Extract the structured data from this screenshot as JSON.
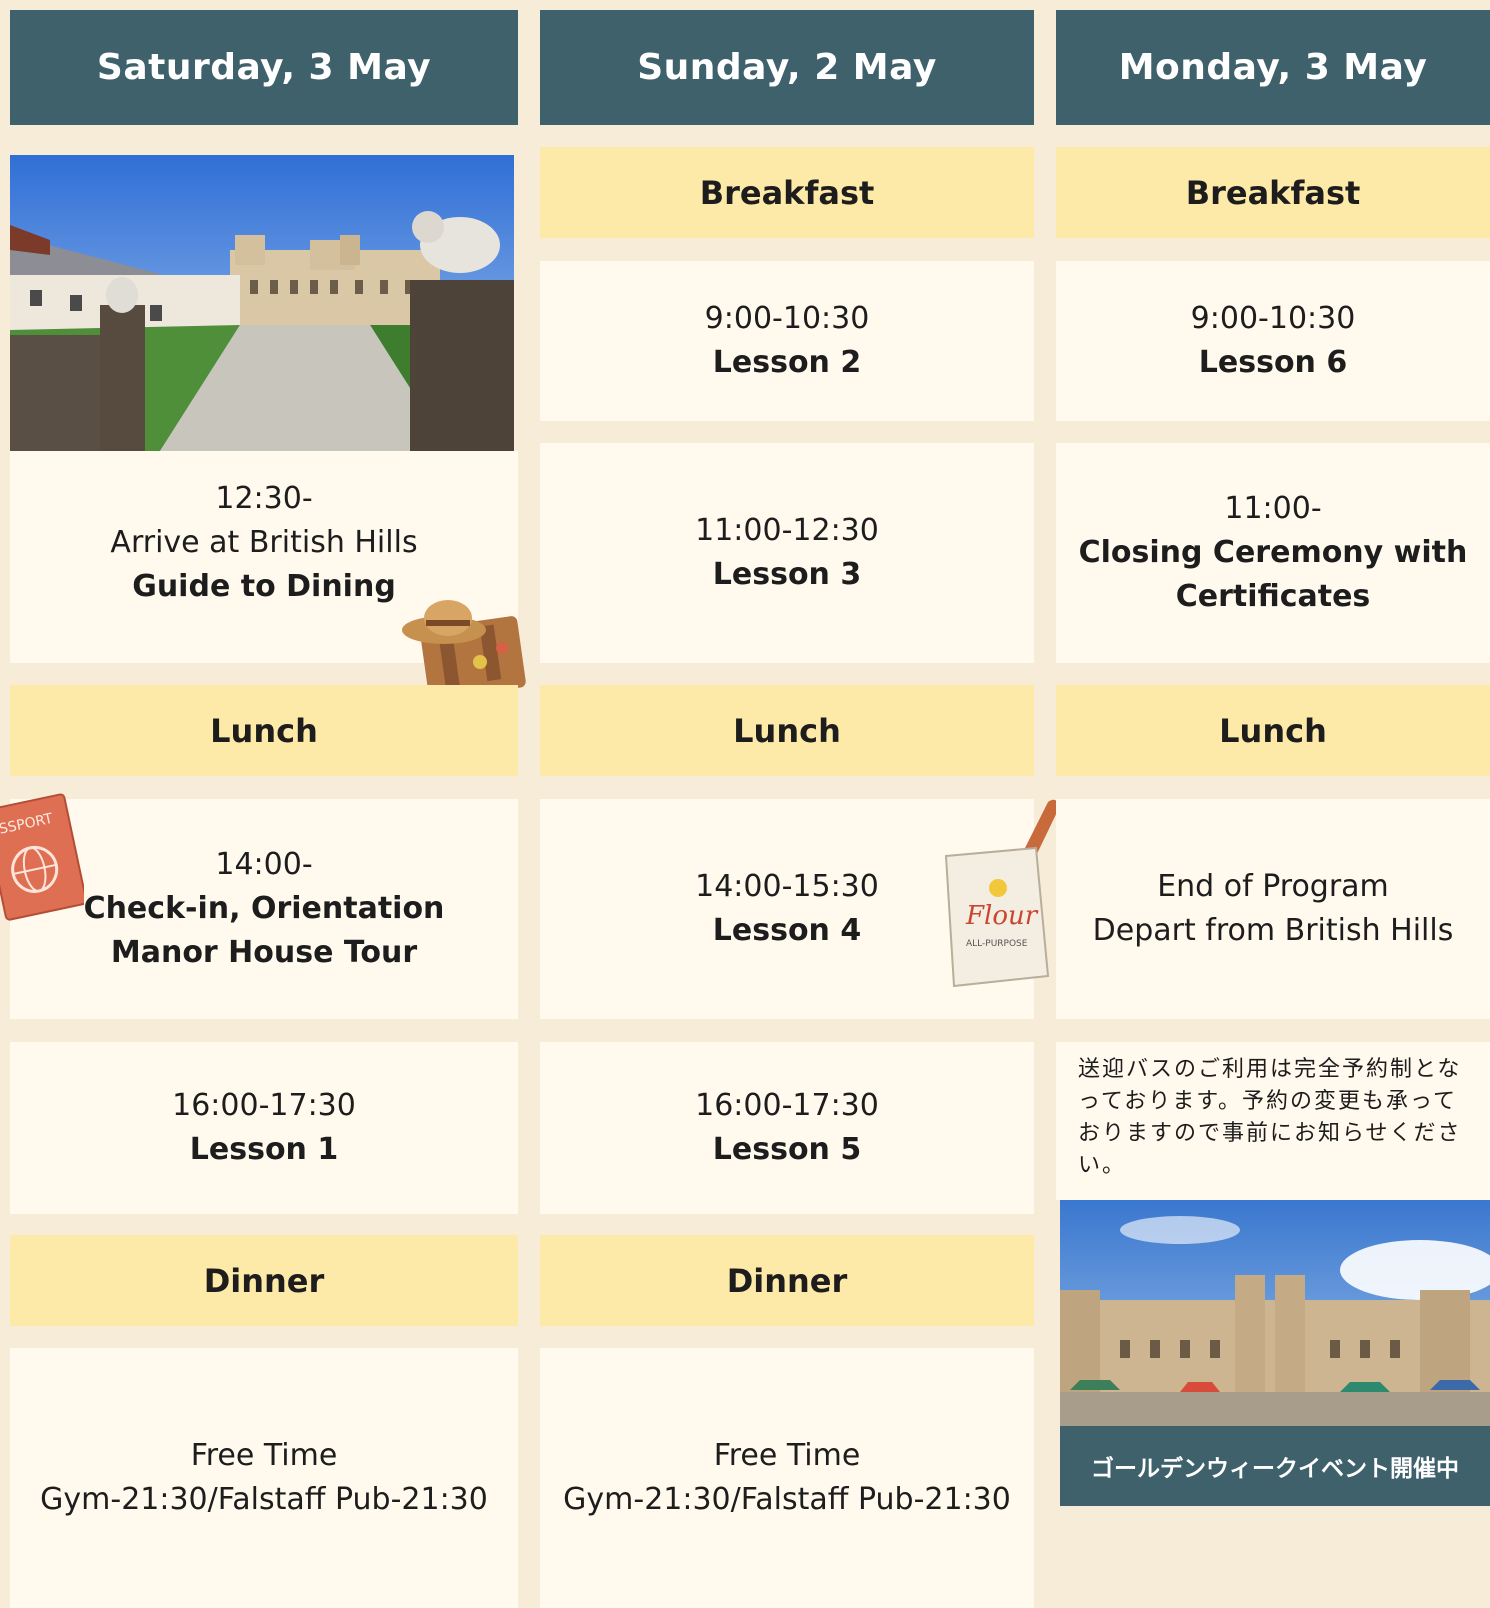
{
  "columns": [
    {
      "header": "Saturday, 3 May"
    },
    {
      "header": "Sunday, 2 May"
    },
    {
      "header": "Monday, 3 May"
    }
  ],
  "meals": {
    "breakfast": "Breakfast",
    "lunch": "Lunch",
    "dinner": "Dinner"
  },
  "saturday": {
    "arrive": {
      "time": "12:30-",
      "line1": "Arrive at British Hills",
      "line2": "Guide to Dining"
    },
    "checkin": {
      "time": "14:00-",
      "line1": "Check-in, Orientation",
      "line2": "Manor House Tour"
    },
    "lesson1": {
      "time": "16:00-17:30",
      "title": "Lesson 1"
    },
    "free": {
      "line1": "Free Time",
      "line2": "Gym-21:30/Falstaff Pub-21:30"
    }
  },
  "sunday": {
    "lesson2": {
      "time": "9:00-10:30",
      "title": "Lesson 2"
    },
    "lesson3": {
      "time": "11:00-12:30",
      "title": "Lesson 3"
    },
    "lesson4": {
      "time": "14:00-15:30",
      "title": "Lesson 4"
    },
    "lesson5": {
      "time": "16:00-17:30",
      "title": "Lesson 5"
    },
    "free": {
      "line1": "Free Time",
      "line2": "Gym-21:30/Falstaff Pub-21:30"
    }
  },
  "monday": {
    "lesson6": {
      "time": "9:00-10:30",
      "title": "Lesson 6"
    },
    "closing": {
      "time": "11:00-",
      "line1": "Closing Ceremony with",
      "line2": "Certificates"
    },
    "end": {
      "line1": "End of Program",
      "line2": "Depart from British Hills"
    },
    "note": "送迎バスのご利用は完全予約制となっております。予約の変更も承っておりますので事前にお知らせください。",
    "banner": "ゴールデンウィークイベント開催中"
  },
  "stickers": {
    "passport_text": "ASSPORT",
    "flour_text": "Flour",
    "flour_sub": "ALL-PURPOSE"
  },
  "icons": [
    "castle-photo",
    "suitcase-hat-icon",
    "passport-icon",
    "flour-bag-icon",
    "castle-event-photo"
  ]
}
